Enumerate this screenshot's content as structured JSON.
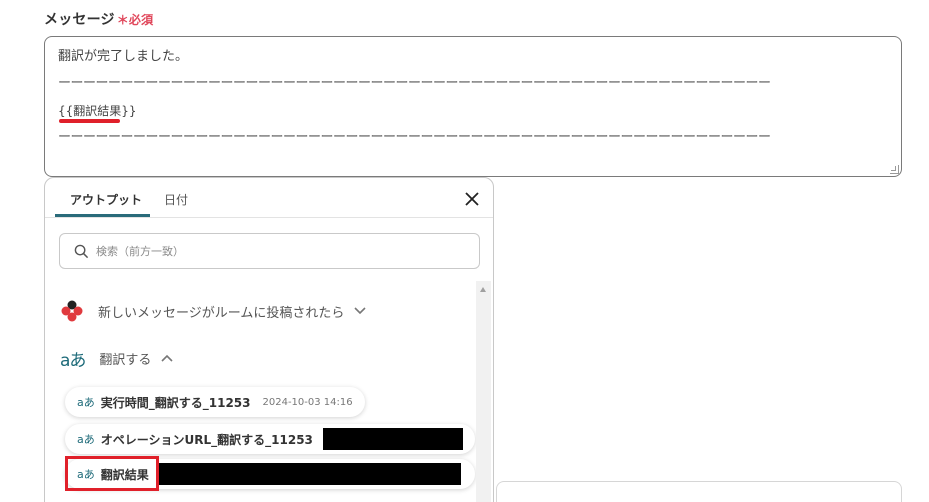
{
  "field": {
    "label": "メッセージ",
    "required": "＊必須"
  },
  "message": {
    "line1": "翻訳が完了しました。",
    "dashes1": "ーーーーーーーーーーーーーーーーーーーーーーーーーーーーーーーーーーーーーーーーーーーーーーーーーーーーーーーーー",
    "variable": "{{翻訳結果}}",
    "dashes2": "ーーーーーーーーーーーーーーーーーーーーーーーーーーーーーーーーーーーーーーーーーーーーーーーーーーーーーーーーー"
  },
  "popup": {
    "tabs": [
      {
        "label": "アウトプット",
        "active": true
      },
      {
        "label": "日付",
        "active": false
      }
    ],
    "close_icon": "close-icon",
    "search": {
      "placeholder": "検索（前方一致）"
    },
    "sections": [
      {
        "label": "新しいメッセージがルームに投稿されたら",
        "icon": "chatwork-logo-icon",
        "expanded": false
      },
      {
        "label": "翻訳する",
        "icon": "translate-icon",
        "expanded": true
      }
    ],
    "items": [
      {
        "icon_text": "aあ",
        "name": "実行時間_翻訳する_11253",
        "meta": "2024-10-03 14:16"
      },
      {
        "icon_text": "aあ",
        "name": "オペレーションURL_翻訳する_11253",
        "meta": ""
      },
      {
        "icon_text": "aあ",
        "name": "翻訳結果",
        "meta": ""
      }
    ]
  },
  "colors": {
    "accent": "#2a6b7a",
    "required": "#e0475b",
    "highlight": "#e0202a"
  }
}
